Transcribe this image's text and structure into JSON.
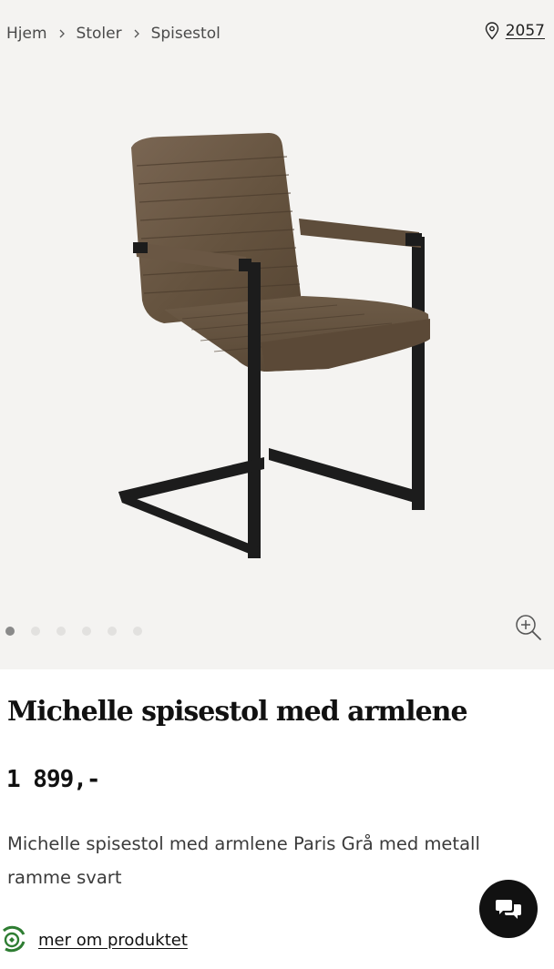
{
  "breadcrumb": {
    "items": [
      "Hjem",
      "Stoler",
      "Spisestol"
    ]
  },
  "store": {
    "icon": "location-pin-icon",
    "number": "2057"
  },
  "gallery": {
    "image_count": 6,
    "active_index": 0,
    "image_alt": "Michelle spisestol med armlene"
  },
  "product": {
    "title": "Michelle spisestol med armlene",
    "price": "1 899,-",
    "description": "Michelle spisestol med armlene Paris Grå med metall ramme svart"
  },
  "links": {
    "more_about": "mer om produktet"
  },
  "colors": {
    "gallery_bg": "#f4f3f1",
    "leather": "#6b5a48",
    "frame": "#1c1c1c",
    "eco_green": "#2e7d32"
  }
}
